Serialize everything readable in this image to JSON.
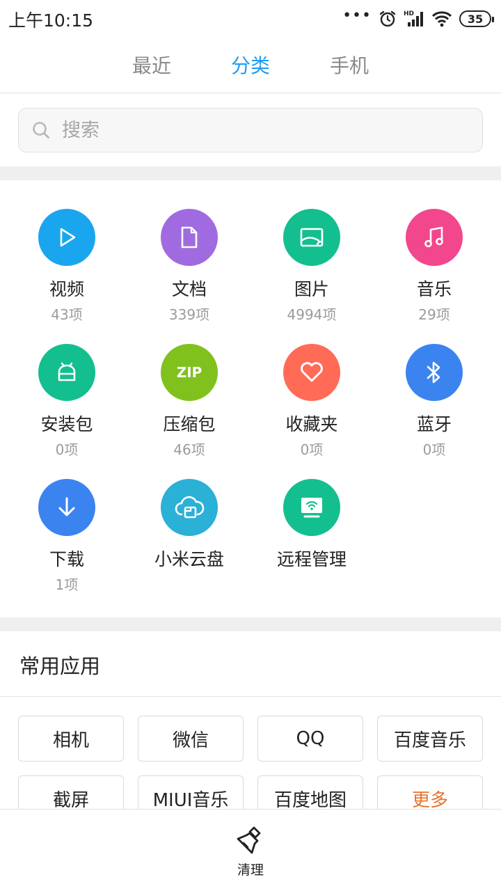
{
  "status_bar": {
    "time": "上午10:15",
    "network": "HD",
    "battery": "35"
  },
  "tabs": [
    {
      "label": "最近"
    },
    {
      "label": "分类"
    },
    {
      "label": "手机"
    }
  ],
  "search": {
    "placeholder": "搜索"
  },
  "categories": [
    {
      "name": "视频",
      "count": "43项",
      "icon": "play-icon",
      "color": "#1aa6ee"
    },
    {
      "name": "文档",
      "count": "339项",
      "icon": "document-icon",
      "color": "#a06be0"
    },
    {
      "name": "图片",
      "count": "4994项",
      "icon": "image-icon",
      "color": "#13bf8e"
    },
    {
      "name": "音乐",
      "count": "29项",
      "icon": "music-note-icon",
      "color": "#f2478c"
    },
    {
      "name": "安装包",
      "count": "0项",
      "icon": "android-icon",
      "color": "#13bf8e"
    },
    {
      "name": "压缩包",
      "count": "46项",
      "icon": "zip-icon",
      "color": "#80c11e",
      "badge": "ZIP"
    },
    {
      "name": "收藏夹",
      "count": "0项",
      "icon": "heart-icon",
      "color": "#ff6b57"
    },
    {
      "name": "蓝牙",
      "count": "0项",
      "icon": "bluetooth-icon",
      "color": "#3b84f0"
    },
    {
      "name": "下载",
      "count": "1项",
      "icon": "download-icon",
      "color": "#3b84f0"
    },
    {
      "name": "小米云盘",
      "count": "",
      "icon": "cloud-icon",
      "color": "#2bb0d6"
    },
    {
      "name": "远程管理",
      "count": "",
      "icon": "remote-icon",
      "color": "#13bf8e"
    }
  ],
  "common_apps": {
    "title": "常用应用",
    "items": [
      "相机",
      "微信",
      "QQ",
      "百度音乐",
      "截屏",
      "MIUI音乐",
      "百度地图",
      "更多"
    ]
  },
  "bottom_bar": {
    "clean_label": "清理"
  },
  "colors": {
    "accent": "#1f9cf0",
    "more": "#e8742a"
  }
}
